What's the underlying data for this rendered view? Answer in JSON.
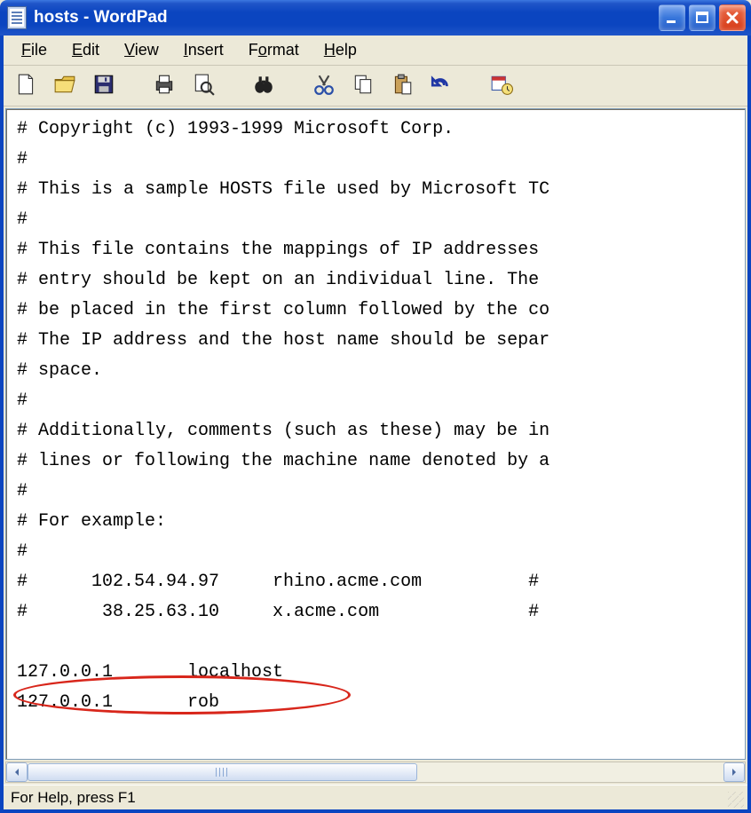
{
  "window": {
    "title": "hosts - WordPad"
  },
  "menu": {
    "file": "File",
    "edit": "Edit",
    "view": "View",
    "insert": "Insert",
    "format": "Format",
    "help": "Help"
  },
  "toolbar": {
    "new": "new-document-icon",
    "open": "open-folder-icon",
    "save": "save-floppy-icon",
    "print": "print-icon",
    "print_preview": "print-preview-icon",
    "find": "find-binoculars-icon",
    "cut": "cut-scissors-icon",
    "copy": "copy-pages-icon",
    "paste": "paste-clipboard-icon",
    "undo": "undo-icon",
    "datetime": "insert-datetime-icon"
  },
  "document_text": "# Copyright (c) 1993-1999 Microsoft Corp.\n#\n# This is a sample HOSTS file used by Microsoft TC\n#\n# This file contains the mappings of IP addresses \n# entry should be kept on an individual line. The \n# be placed in the first column followed by the co\n# The IP address and the host name should be separ\n# space.\n#\n# Additionally, comments (such as these) may be in\n# lines or following the machine name denoted by a\n#\n# For example:\n#\n#      102.54.94.97     rhino.acme.com          # \n#       38.25.63.10     x.acme.com              # \n\n127.0.0.1       localhost\n127.0.0.1       rob",
  "status": {
    "text": "For Help, press F1"
  },
  "annotation": {
    "highlighted_line": "127.0.0.1       rob"
  }
}
